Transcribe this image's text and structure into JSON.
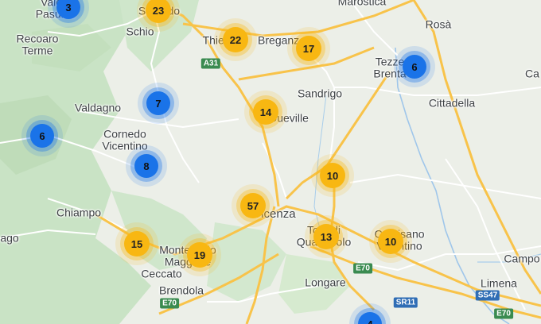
{
  "map": {
    "colors": {
      "land": "#ecefe8",
      "vegetation": "#c9e3c5",
      "river": "#9fc6ea",
      "road_major": "#f8c34a",
      "road_minor": "#ffffff",
      "cluster_yellow": "#f8b712",
      "cluster_blue": "#1a73e8"
    },
    "places": {
      "valdelpasio": [
        "Valdel",
        "Pasubio"
      ],
      "sarego": "Sarcedo",
      "schio": "Schio",
      "thiene": "Thiene",
      "breganze": "Breganze",
      "marostica": "Marostica",
      "rosa": "Rosà",
      "recoaro": [
        "Recoaro",
        "Terme"
      ],
      "tezze": [
        "Tezze",
        "Brenta"
      ],
      "sandrigo": "Sandrigo",
      "cittadella": "Cittadella",
      "valdagno": "Valdagno",
      "cornedo": [
        "Cornedo",
        "Vicentino"
      ],
      "dueville": "Dueville",
      "ca": "Ca",
      "vicenza": "Vicenza",
      "chiampo": "Chiampo",
      "arzignano": "ago",
      "montecchio": [
        "Montecchio",
        "Maggiore"
      ],
      "ceccato": "Ceccato",
      "torri": [
        "Torri di",
        "Quartesolo"
      ],
      "camisano": [
        "Camisano",
        "Vicentino"
      ],
      "campo": "Campo",
      "brendola": "Brendola",
      "longare": "Longare",
      "limena": "Limena"
    },
    "shields": {
      "a31": "A31",
      "e70_w": "E70",
      "e70_c": "E70",
      "sr11": "SR11",
      "ss47": "SS47",
      "e70_e": "E70"
    },
    "clusters": [
      {
        "id": "valdelpasubio",
        "count": "3",
        "color": "blue"
      },
      {
        "id": "sarcedo",
        "count": "23",
        "color": "yellow"
      },
      {
        "id": "thiene",
        "count": "22",
        "color": "yellow"
      },
      {
        "id": "breganze",
        "count": "17",
        "color": "yellow"
      },
      {
        "id": "tezze",
        "count": "6",
        "color": "blue"
      },
      {
        "id": "valdagno",
        "count": "7",
        "color": "blue"
      },
      {
        "id": "dueville",
        "count": "14",
        "color": "yellow"
      },
      {
        "id": "west",
        "count": "6",
        "color": "blue"
      },
      {
        "id": "cornedo",
        "count": "8",
        "color": "blue"
      },
      {
        "id": "bolzano",
        "count": "10",
        "color": "yellow"
      },
      {
        "id": "vicenza",
        "count": "57",
        "color": "yellow"
      },
      {
        "id": "torri",
        "count": "13",
        "color": "yellow"
      },
      {
        "id": "camisano",
        "count": "10",
        "color": "yellow"
      },
      {
        "id": "montecchio-w",
        "count": "15",
        "color": "yellow"
      },
      {
        "id": "montecchio",
        "count": "19",
        "color": "yellow"
      },
      {
        "id": "longare-s",
        "count": "4",
        "color": "blue"
      }
    ]
  }
}
